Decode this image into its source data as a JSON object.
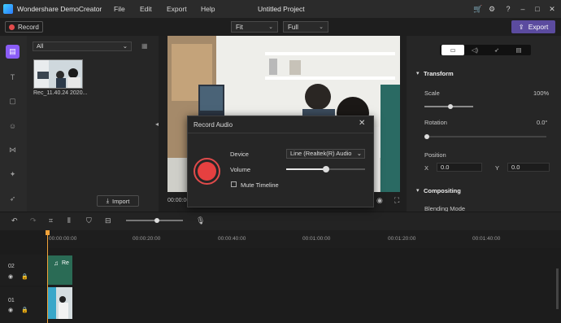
{
  "app": {
    "name": "Wondershare DemoCreator",
    "window_title": "Untitled Project"
  },
  "menu": {
    "file": "File",
    "edit": "Edit",
    "export": "Export",
    "help": "Help"
  },
  "toolbar": {
    "record_label": "Record",
    "fit_value": "Fit",
    "quality_value": "Full",
    "export_label": "Export"
  },
  "media": {
    "filter_value": "All",
    "clip_name": "Rec_11.40.24 2020...",
    "import_label": "Import"
  },
  "preview": {
    "timecode": "00:00:00"
  },
  "properties": {
    "transform_heading": "Transform",
    "scale_label": "Scale",
    "scale_value": "100%",
    "rotation_label": "Rotation",
    "rotation_value": "0.0°",
    "position_label": "Position",
    "x_label": "X",
    "x_value": "0.0",
    "y_label": "Y",
    "y_value": "0.0",
    "compositing_heading": "Compositing",
    "blending_label": "Blending Mode"
  },
  "timeline": {
    "ruler": [
      "00:00:00:00",
      "00:00:20:00",
      "00:00:40:00",
      "00:01:00:00",
      "00:01:20:00",
      "00:01:40:00"
    ],
    "track2": "02",
    "track1": "01",
    "audio_clip_label": "Re"
  },
  "dialog": {
    "title": "Record Audio",
    "device_label": "Device",
    "device_value": "Line (Realtek(R) Audio",
    "volume_label": "Volume",
    "mute_label": "Mute Timeline",
    "volume_level": 0.5
  },
  "colors": {
    "accent": "#8a5cf6",
    "record": "#e64040",
    "export": "#5b4b9f",
    "playhead": "#f0a23a"
  }
}
